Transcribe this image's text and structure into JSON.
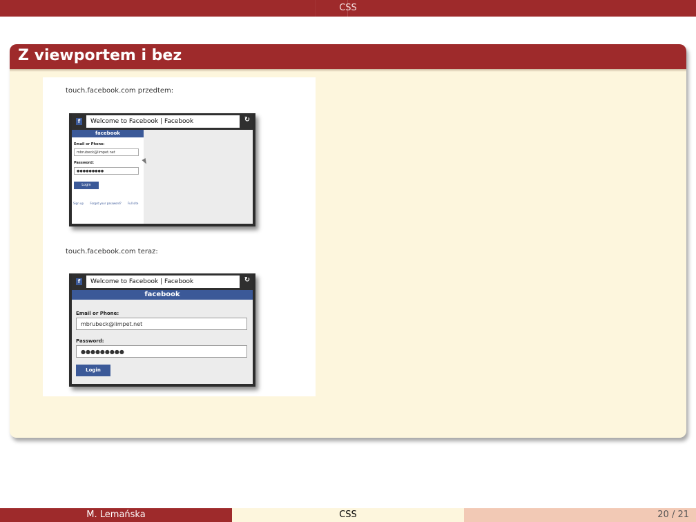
{
  "header": {
    "section": "CSS"
  },
  "frame": {
    "title": "Z viewportem i bez"
  },
  "image": {
    "caption_before": "touch.facebook.com przedtem:",
    "caption_after": "touch.facebook.com teraz:",
    "browser": {
      "fb_icon": "f",
      "url_title": "Welcome to Facebook | Facebook",
      "reload_icon": "↻"
    },
    "login": {
      "brand": "facebook",
      "email_label": "Email or Phone:",
      "email_value": "mbrubeck@limpet.net",
      "password_label": "Password:",
      "password_value": "●●●●●●●●●",
      "login_button": "Login",
      "links": [
        "Sign up",
        "Forgot your password?",
        "Full site"
      ]
    }
  },
  "footer": {
    "author": "M. Lemańska",
    "title": "CSS",
    "page": "20 / 21"
  },
  "colors": {
    "accent": "#9e2a2b",
    "frame_bg": "#fdf6dd",
    "facebook_blue": "#3b5998"
  }
}
